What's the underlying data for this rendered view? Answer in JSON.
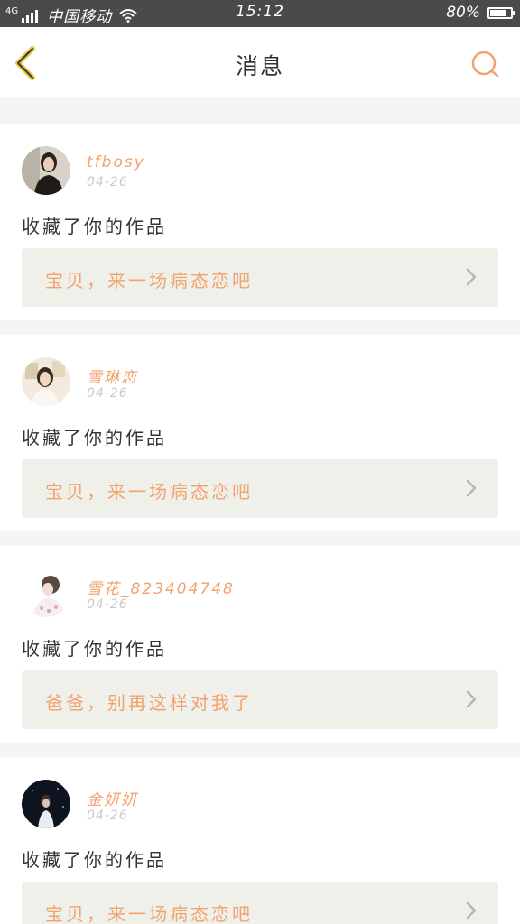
{
  "status_bar": {
    "network": "4G",
    "carrier": "中国移动",
    "time": "15:12",
    "battery": "80%",
    "battery_level": 0.8,
    "icons": [
      "signal-icon",
      "wifi-icon",
      "battery-icon"
    ]
  },
  "header": {
    "title": "消息",
    "back_icon": "chevron-left-icon",
    "search_icon": "search-icon"
  },
  "colors": {
    "accent": "#f1a26e",
    "back_icon": "#e8c842",
    "status_bar_bg": "#4a4a4a",
    "card_box_bg": "#f0f0ea",
    "page_bg": "#f5f5f5"
  },
  "notifications": [
    {
      "username": "tfbosy",
      "date": "04-26",
      "action": "收藏了你的作品",
      "work_title": "宝贝，来一场病态恋吧"
    },
    {
      "username": "雪琳恋",
      "date": "04-26",
      "action": "收藏了你的作品",
      "work_title": "宝贝，来一场病态恋吧"
    },
    {
      "username": "雪花_823404748",
      "date": "04-26",
      "action": "收藏了你的作品",
      "work_title": "爸爸，别再这样对我了"
    },
    {
      "username": "金妍妍",
      "date": "04-26",
      "action": "收藏了你的作品",
      "work_title": "宝贝，来一场病态恋吧"
    }
  ]
}
